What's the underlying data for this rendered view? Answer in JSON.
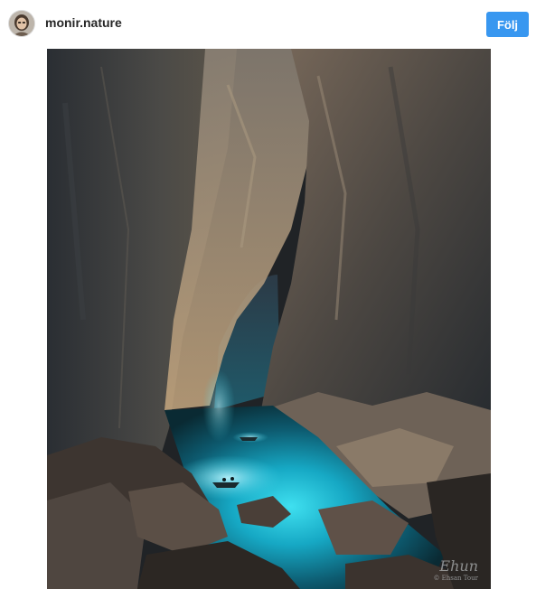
{
  "post": {
    "username": "monir.nature",
    "follow_label": "Följ"
  },
  "photo": {
    "subject": "underground cave river with turquoise water and small boats",
    "signature": {
      "scribble": "Ehun",
      "credit": "© Ehsan Tour"
    }
  }
}
